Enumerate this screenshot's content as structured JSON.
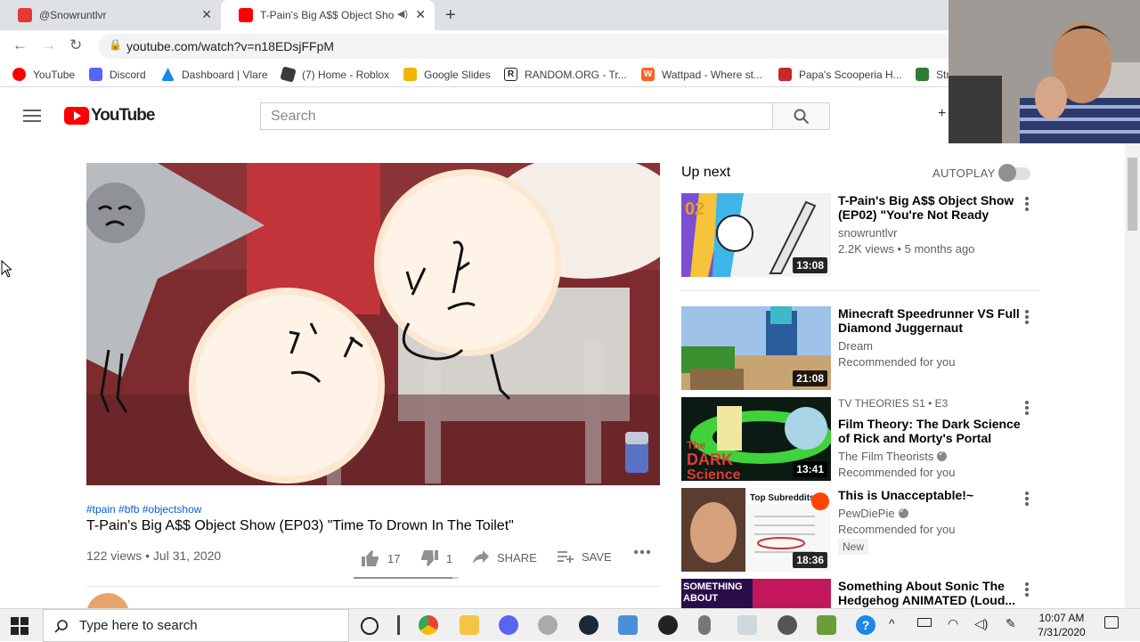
{
  "browser": {
    "tabs": [
      {
        "title": "@Snowruntlvr",
        "active": false
      },
      {
        "title": "T-Pain's Big A$$ Object Show",
        "active": true
      }
    ],
    "url": "youtube.com/watch?v=n18EDsjFFpM",
    "bookmarks": [
      {
        "label": "YouTube",
        "icon": "youtube-icon",
        "color": "#ff0000"
      },
      {
        "label": "Discord",
        "icon": "discord-icon",
        "color": "#5865f2"
      },
      {
        "label": "Dashboard | Vlare",
        "icon": "vlare-icon",
        "color": "#1e88e5"
      },
      {
        "label": "(7) Home - Roblox",
        "icon": "roblox-icon",
        "color": "#393b3d"
      },
      {
        "label": "Google Slides",
        "icon": "slides-icon",
        "color": "#f4b400"
      },
      {
        "label": "RANDOM.ORG - Tr...",
        "icon": "random-org-icon",
        "color": "#222222"
      },
      {
        "label": "Wattpad - Where st...",
        "icon": "wattpad-icon",
        "color": "#ff6122"
      },
      {
        "label": "Papa's Scooperia H...",
        "icon": "papas-icon",
        "color": "#c62828"
      },
      {
        "label": "Str",
        "icon": "steam-icon",
        "color": "#2e7d32"
      }
    ]
  },
  "youtube": {
    "logo_text": "YouTube",
    "search_placeholder": "Search"
  },
  "video": {
    "hashtags": "#tpain #bfb #objectshow",
    "title": "T-Pain's Big A$$ Object Show (EP03) \"Time To Drown In The Toilet\"",
    "views_date": "122 views • Jul 31, 2020",
    "likes": "17",
    "dislikes": "1",
    "like_ratio": 0.94,
    "share_label": "SHARE",
    "save_label": "SAVE"
  },
  "sidebar": {
    "up_next_label": "Up next",
    "autoplay_label": "AUTOPLAY",
    "autoplay_on": false,
    "items": [
      {
        "title": "T-Pain's Big A$$ Object Show (EP02) \"You're Not Ready For...",
        "channel": "snowruntlvr",
        "meta": "2.2K views • 5 months ago",
        "duration": "13:08",
        "verified": false
      },
      {
        "title": "Minecraft Speedrunner VS Full Diamond Juggernaut",
        "channel": "Dream",
        "meta": "Recommended for you",
        "duration": "21:08",
        "verified": false
      },
      {
        "kicker": "TV THEORIES  S1 • E3",
        "title": "Film Theory: The Dark Science of Rick and Morty's Portal Gun...",
        "channel": "The Film Theorists",
        "meta": "Recommended for you",
        "duration": "13:41",
        "verified": true,
        "thumb_text": "The DARK Science"
      },
      {
        "title": "This is Unacceptable!~",
        "channel": "PewDiePie",
        "meta": "Recommended for you",
        "duration": "18:36",
        "verified": true,
        "badge": "New",
        "thumb_text": "Top Subreddits"
      },
      {
        "title": "Something About Sonic The Hedgehog ANIMATED (Loud...",
        "thumb_text": "SOMETHING ABOUT"
      }
    ]
  },
  "taskbar": {
    "search_placeholder": "Type here to search",
    "time": "10:07 AM",
    "date": "7/31/2020"
  }
}
